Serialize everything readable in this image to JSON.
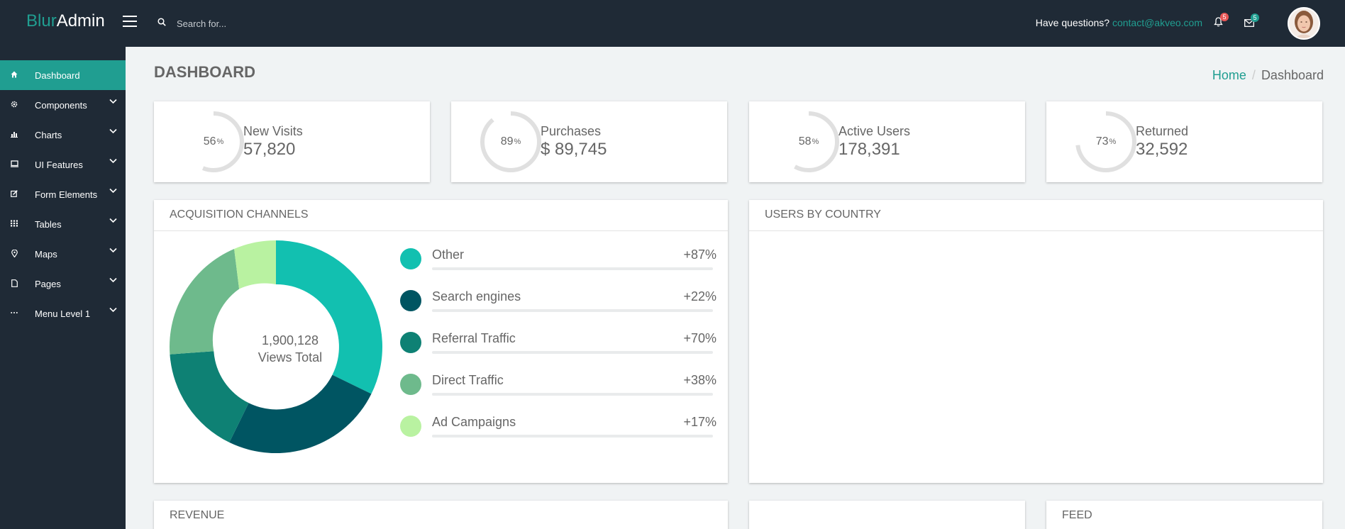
{
  "brand": {
    "part1": "Blur",
    "part2": "Admin"
  },
  "search": {
    "placeholder": "Search for..."
  },
  "header": {
    "questions": "Have questions?",
    "email": "contact@akveo.com",
    "notifications_count": "5",
    "messages_count": "5"
  },
  "sidebar": {
    "items": [
      {
        "label": "Dashboard",
        "icon": "home-icon"
      },
      {
        "label": "Components",
        "icon": "gear-icon"
      },
      {
        "label": "Charts",
        "icon": "bar-chart-icon"
      },
      {
        "label": "UI Features",
        "icon": "monitor-icon"
      },
      {
        "label": "Form Elements",
        "icon": "edit-icon"
      },
      {
        "label": "Tables",
        "icon": "grid-icon"
      },
      {
        "label": "Maps",
        "icon": "map-pin-icon"
      },
      {
        "label": "Pages",
        "icon": "file-icon"
      },
      {
        "label": "Menu Level 1",
        "icon": "ellipsis-icon"
      }
    ]
  },
  "page": {
    "title": "DASHBOARD"
  },
  "breadcrumb": {
    "home": "Home",
    "current": "Dashboard"
  },
  "stats": [
    {
      "pct": "56",
      "pct_unit": "%",
      "label": "New Visits",
      "value": "57,820",
      "fraction": 0.56
    },
    {
      "pct": "89",
      "pct_unit": "%",
      "label": "Purchases",
      "value": "$ 89,745",
      "fraction": 0.89
    },
    {
      "pct": "58",
      "pct_unit": "%",
      "label": "Active Users",
      "value": "178,391",
      "fraction": 0.58
    },
    {
      "pct": "73",
      "pct_unit": "%",
      "label": "Returned",
      "value": "32,592",
      "fraction": 0.73
    }
  ],
  "acquisition": {
    "title": "ACQUISITION CHANNELS",
    "total_value": "1,900,128",
    "total_label": "Views Total",
    "channels": [
      {
        "label": "Other",
        "value": "+87%",
        "color": "#12c0b0"
      },
      {
        "label": "Search engines",
        "value": "+22%",
        "color": "#005562"
      },
      {
        "label": "Referral Traffic",
        "value": "+70%",
        "color": "#0e8174"
      },
      {
        "label": "Direct Traffic",
        "value": "+38%",
        "color": "#6eba8c"
      },
      {
        "label": "Ad Campaigns",
        "value": "+17%",
        "color": "#b9f2a1"
      }
    ]
  },
  "country": {
    "title": "USERS BY COUNTRY"
  },
  "revenue": {
    "title": "REVENUE"
  },
  "feed": {
    "title": "FEED"
  },
  "colors": {
    "accent": "#209e91",
    "topbar": "#1f2a36",
    "ring_track": "#e0e0e0"
  }
}
